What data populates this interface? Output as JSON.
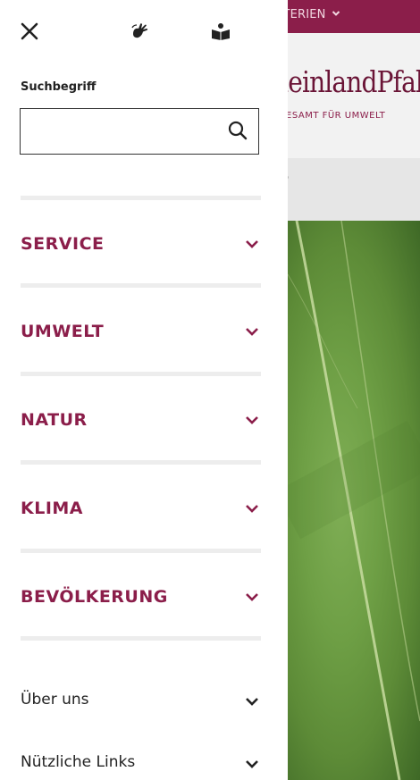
{
  "background": {
    "topbar_text": "STERIEN",
    "logo_text": "heinlandPfalz",
    "logo_subtitle": "ESAMT FÜR UMWELT",
    "subnav_mark": "S"
  },
  "drawer": {
    "search": {
      "label": "Suchbegriff",
      "value": "",
      "placeholder": ""
    },
    "menu": [
      {
        "label": "SERVICE"
      },
      {
        "label": "UMWELT"
      },
      {
        "label": "NATUR"
      },
      {
        "label": "KLIMA"
      },
      {
        "label": "BEVÖLKERUNG"
      }
    ],
    "links": [
      {
        "label": "Über uns"
      },
      {
        "label": "Nützliche Links"
      }
    ]
  },
  "colors": {
    "brand": "#8b1e4a",
    "divider": "#ededed",
    "text": "#222222"
  },
  "icons": {
    "close": "close-icon",
    "sign_language": "sign-language-icon",
    "easy_reading": "easy-reading-icon",
    "search": "search-icon",
    "chevron": "chevron-down-icon"
  }
}
